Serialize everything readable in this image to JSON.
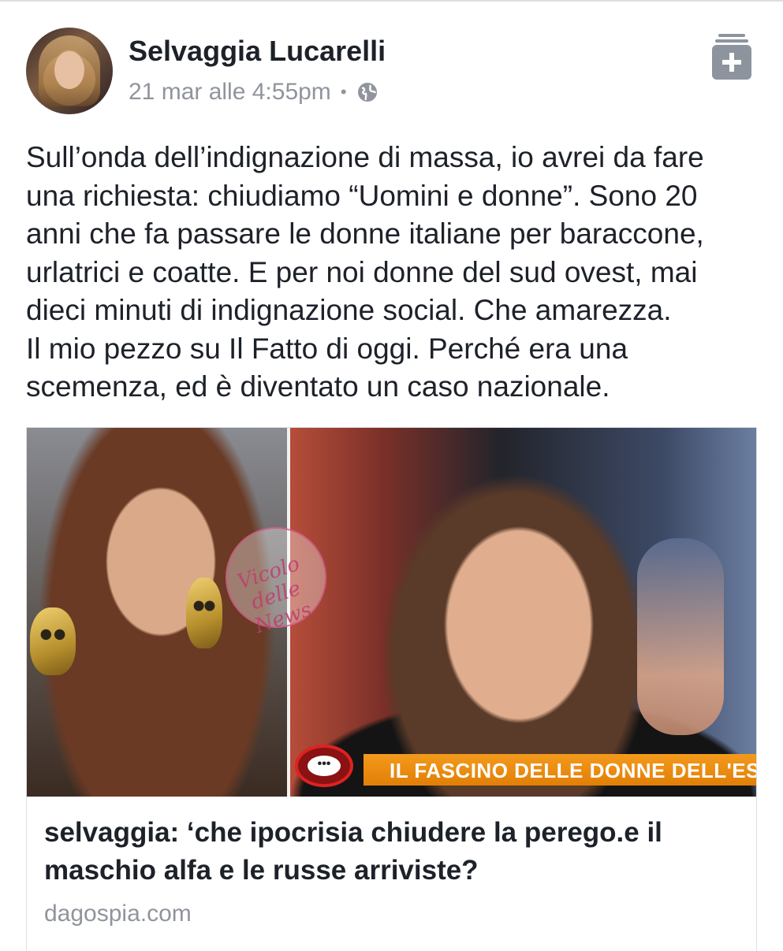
{
  "post": {
    "author": "Selvaggia Lucarelli",
    "timestamp": "21 mar alle 4:55pm",
    "separator": "•",
    "privacy_icon": "globe-icon",
    "save_icon": "save-bookmark-plus-icon",
    "text_lines": [
      "Sull’onda dell’indignazione di massa, io avrei da fare una richiesta: chiudiamo “Uomini e donne”. Sono 20 anni che fa passare le donne italiane per baraccone, urlatrici e coatte. E per noi donne del sud ovest, mai dieci minuti di indignazione social. Che amarezza.",
      "Il mio pezzo su Il Fatto di oggi. Perché era una scemenza, ed è diventato un caso nazionale."
    ]
  },
  "link_card": {
    "image": {
      "banner_text": "IL FASCINO DELLE DONNE DELL'EST",
      "badge_text": "•••",
      "watermark_text": "Vicolo delle News"
    },
    "title": "selvaggia: ‘che ipocrisia chiudere la perego.e il maschio alfa e le russe arriviste?",
    "domain": "dagospia.com"
  },
  "colors": {
    "text_primary": "#1d2129",
    "text_secondary": "#90949c",
    "banner_orange": "#e17f06"
  }
}
